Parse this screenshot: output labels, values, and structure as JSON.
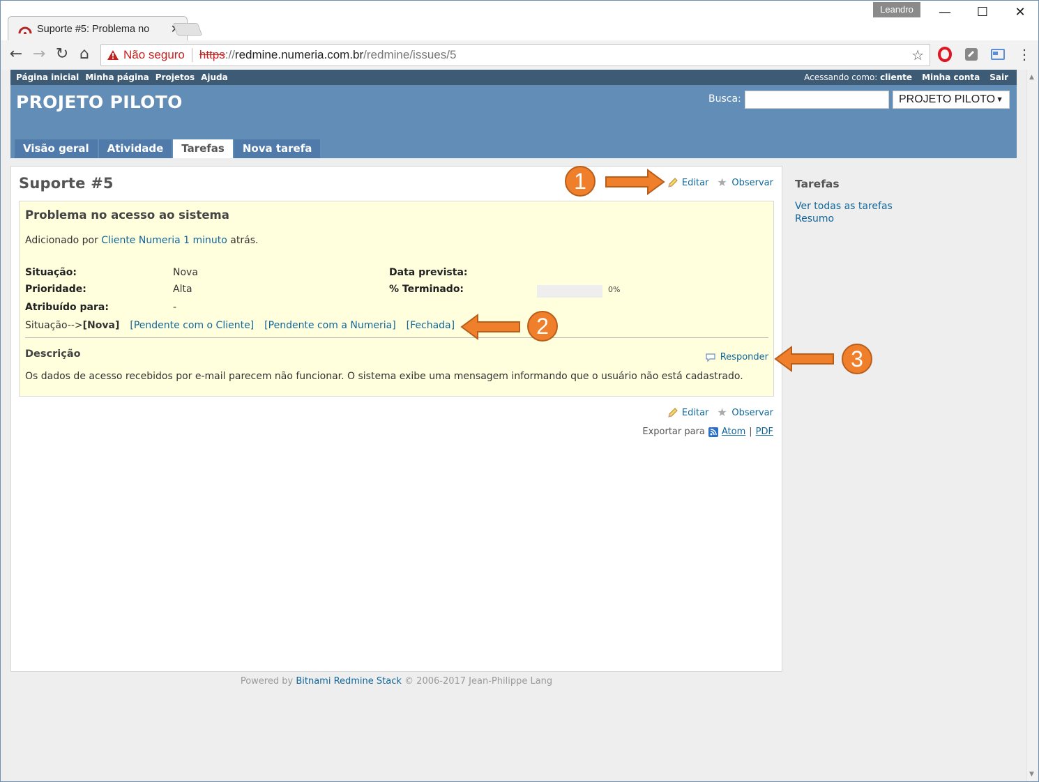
{
  "browser": {
    "tab_title": "Suporte #5: Problema no",
    "tab_close": "✕",
    "profile_name": "Leandro",
    "not_secure": "Não seguro",
    "url_scheme": "https",
    "url_sep": "://",
    "url_host": "redmine.numeria.com.br",
    "url_path": "/redmine/issues/5",
    "win_minimize": "—",
    "win_maximize": "☐",
    "win_close": "✕",
    "nav_back": "←",
    "nav_forward": "→",
    "nav_reload": "↻",
    "nav_home": "⌂",
    "bookmark_star": "☆",
    "menu_dots": "⋮",
    "accent_warning": "#c5221f"
  },
  "top_menu": {
    "items": [
      "Página inicial",
      "Minha página",
      "Projetos",
      "Ajuda"
    ],
    "logged_as_label": "Acessando como:",
    "logged_as_user": "cliente",
    "my_account": "Minha conta",
    "logout": "Sair"
  },
  "header": {
    "project_title": "PROJETO PILOTO",
    "search_label": "Busca:",
    "search_value": "",
    "project_select_value": "PROJETO PILOTO",
    "select_caret": "▼",
    "bg_color": "#628db6"
  },
  "main_menu": {
    "tabs": [
      "Visão geral",
      "Atividade",
      "Tarefas",
      "Nova tarefa"
    ],
    "selected": "Tarefas"
  },
  "issue": {
    "heading": "Suporte #5",
    "edit_label": "Editar",
    "watch_label": "Observar",
    "subject": "Problema no acesso ao sistema",
    "added_by_prefix": "Adicionado por",
    "author": "Cliente Numeria",
    "time_ago": "1 minuto",
    "time_suffix": "atrás.",
    "attributes": {
      "status_label": "Situação:",
      "status_value": "Nova",
      "priority_label": "Prioridade:",
      "priority_value": "Alta",
      "assigned_label": "Atribuído para:",
      "assigned_value": "-",
      "due_label": "Data prevista:",
      "due_value": "",
      "done_label": "% Terminado:",
      "done_percent_text": "0%",
      "done_ratio": 0
    },
    "transitions": {
      "prefix": "Situação-->",
      "current": "[Nova]",
      "options": [
        "[Pendente com o Cliente]",
        "[Pendente com a Numeria]",
        "[Fechada]"
      ]
    },
    "description_label": "Descrição",
    "reply_label": "Responder",
    "description_text": "Os dados de acesso recebidos por e-mail parecem não funcionar. O sistema exibe uma mensagem informando que o usuário não está cadastrado.",
    "box_color": "#ffffdd"
  },
  "export": {
    "label": "Exportar para",
    "atom": "Atom",
    "sep": "|",
    "pdf": "PDF"
  },
  "sidebar": {
    "title": "Tarefas",
    "links": [
      "Ver todas as tarefas",
      "Resumo"
    ]
  },
  "footer": {
    "powered_by": "Powered by",
    "link": "Bitnami Redmine Stack",
    "copyright": "© 2006-2017 Jean-Philippe Lang"
  },
  "annotations": {
    "markers": [
      "1",
      "2",
      "3"
    ],
    "color": "#f07f2c"
  }
}
